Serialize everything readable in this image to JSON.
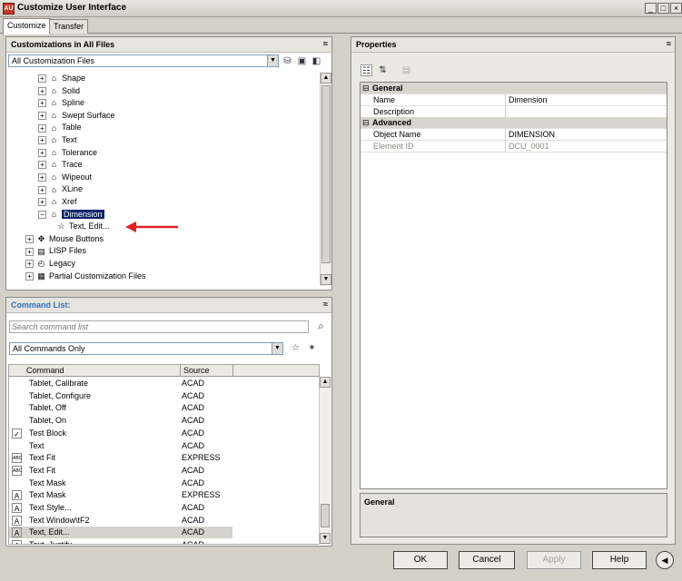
{
  "window": {
    "title": "Customize User Interface",
    "app_icon_text": "AU",
    "min": "_",
    "max": "□",
    "close": "×"
  },
  "tabs": [
    "Customize",
    "Transfer"
  ],
  "customizations": {
    "header": "Customizations in All Files",
    "collapse": "≈",
    "file_filter": "All Customization Files",
    "tree": [
      {
        "label": "Shape",
        "level": 2
      },
      {
        "label": "Solid",
        "level": 2
      },
      {
        "label": "Spline",
        "level": 2
      },
      {
        "label": "Swept Surface",
        "level": 2
      },
      {
        "label": "Table",
        "level": 2
      },
      {
        "label": "Text",
        "level": 2
      },
      {
        "label": "Tolerance",
        "level": 2
      },
      {
        "label": "Trace",
        "level": 2
      },
      {
        "label": "Wipeout",
        "level": 2
      },
      {
        "label": "XLine",
        "level": 2
      },
      {
        "label": "Xref",
        "level": 2
      },
      {
        "label": "Dimension",
        "level": 2
      },
      {
        "label": "Text, Edit...",
        "level": 3
      },
      {
        "label": "Mouse Buttons",
        "level": 1
      },
      {
        "label": "LISP Files",
        "level": 1
      },
      {
        "label": "Legacy",
        "level": 1
      },
      {
        "label": "Partial Customization Files",
        "level": 1
      }
    ]
  },
  "commands": {
    "header": "Command List:",
    "collapse": "≈",
    "search_placeholder": "Search command list",
    "filter": "All Commands Only",
    "col_command": "Command",
    "col_source": "Source",
    "rows": [
      {
        "name": "Tablet, Calibrate",
        "source": "ACAD",
        "icon": ""
      },
      {
        "name": "Tablet, Configure",
        "source": "ACAD",
        "icon": ""
      },
      {
        "name": "Tablet, Off",
        "source": "ACAD",
        "icon": ""
      },
      {
        "name": "Tablet, On",
        "source": "ACAD",
        "icon": ""
      },
      {
        "name": "Test Block",
        "source": "ACAD",
        "icon": "✓"
      },
      {
        "name": "Text",
        "source": "ACAD",
        "icon": ""
      },
      {
        "name": "Text Fit",
        "source": "EXPRESS",
        "icon": "ABC"
      },
      {
        "name": "Text Fit",
        "source": "ACAD",
        "icon": "ABC"
      },
      {
        "name": "Text Mask",
        "source": "ACAD",
        "icon": ""
      },
      {
        "name": "Text Mask",
        "source": "EXPRESS",
        "icon": "A"
      },
      {
        "name": "Text Style...",
        "source": "ACAD",
        "icon": "A"
      },
      {
        "name": "Text Window\\tF2",
        "source": "ACAD",
        "icon": "A"
      },
      {
        "name": "Text, Edit...",
        "source": "ACAD",
        "icon": "A"
      },
      {
        "name": "Text, Justify",
        "source": "ACAD",
        "icon": "A"
      }
    ]
  },
  "properties": {
    "header": "Properties",
    "collapse": "≈",
    "rows": [
      {
        "kind": "cat",
        "name": "General",
        "toggle": "⊟"
      },
      {
        "kind": "prop",
        "name": "Name",
        "value": "Dimension"
      },
      {
        "kind": "prop",
        "name": "Description",
        "value": ""
      },
      {
        "kind": "cat",
        "name": "Advanced",
        "toggle": "⊟"
      },
      {
        "kind": "prop",
        "name": "Object Name",
        "value": "DIMENSION"
      },
      {
        "kind": "prop-dim",
        "name": "Element ID",
        "value": "DCU_0001"
      }
    ],
    "description_title": "General"
  },
  "buttons": {
    "ok": "OK",
    "cancel": "Cancel",
    "apply": "Apply",
    "help": "Help",
    "more": "◀"
  },
  "colors": {
    "selection": "#0a246a",
    "arrow": "#e02020"
  }
}
